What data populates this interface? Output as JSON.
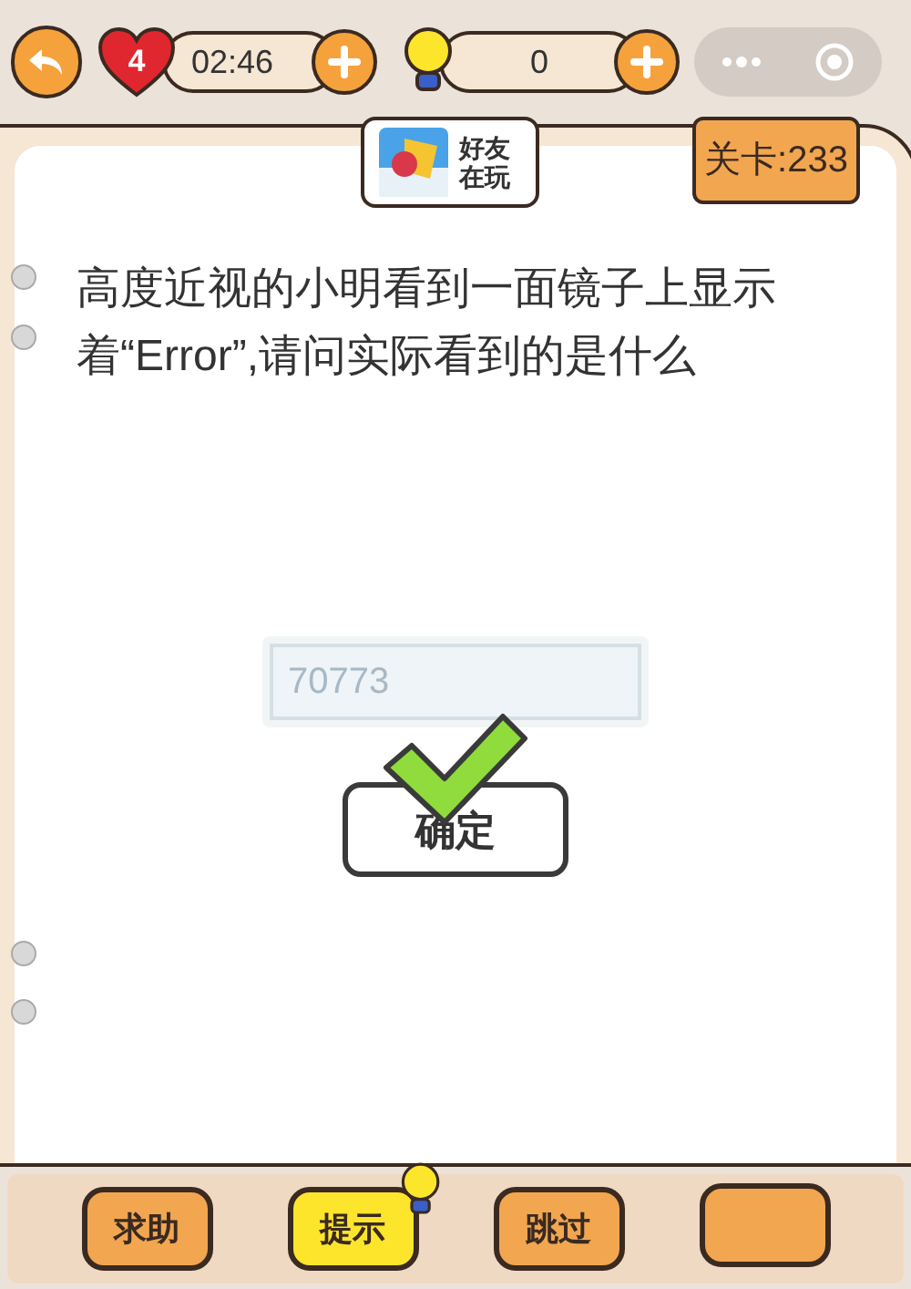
{
  "top_bar": {
    "lives": "4",
    "timer": "02:46",
    "hints": "0"
  },
  "friends_badge": {
    "label": "好友在玩"
  },
  "level_tag": "关卡:233",
  "question": "高度近视的小明看到一面镜子上显示着“Error”,请问实际看到的是什么",
  "answer": {
    "value": "70773",
    "correct": true
  },
  "confirm_button": "确定",
  "bottom_buttons": [
    {
      "label": "求助",
      "kind": "plain"
    },
    {
      "label": "提示",
      "kind": "hint"
    },
    {
      "label": "跳过",
      "kind": "plain"
    },
    {
      "kind": "plain"
    }
  ]
}
